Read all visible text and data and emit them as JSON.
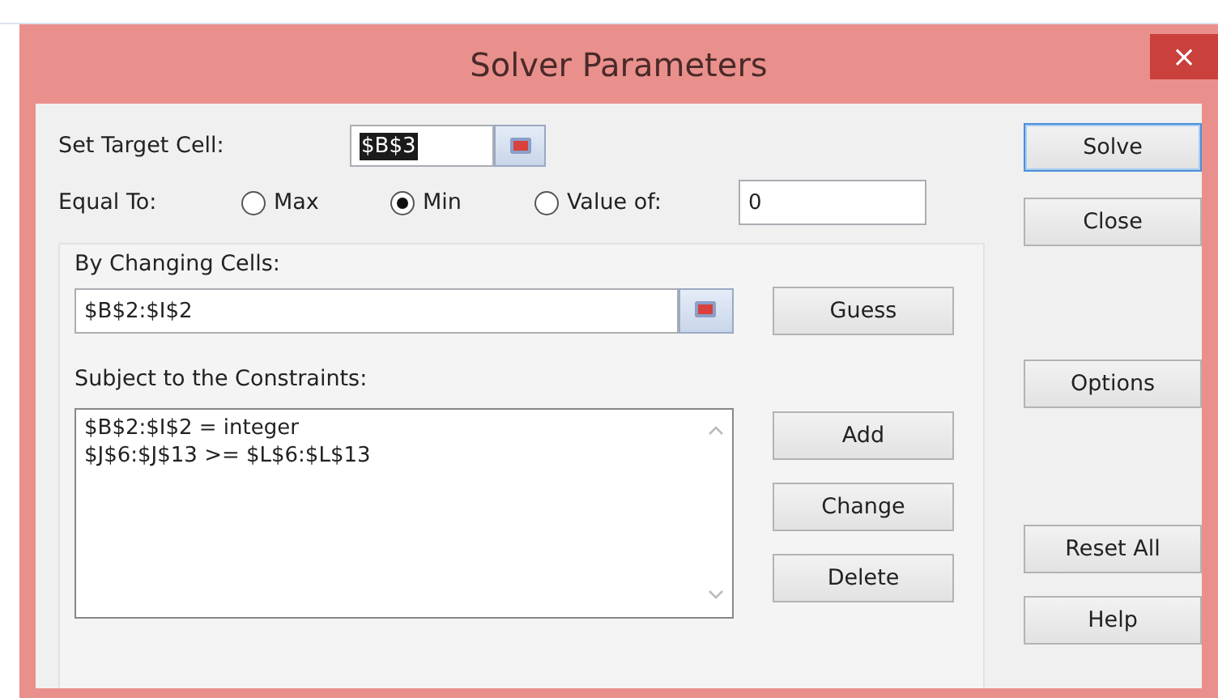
{
  "window": {
    "title": "Solver Parameters",
    "close": "×"
  },
  "target": {
    "label": "Set Target Cell:",
    "value": "$B$3",
    "value_selected": true
  },
  "equal_to": {
    "label": "Equal To:",
    "options": [
      {
        "label": "Max",
        "selected": false
      },
      {
        "label": "Min",
        "selected": true
      },
      {
        "label": "Value of:",
        "selected": false
      }
    ],
    "value": "0"
  },
  "changing": {
    "label": "By Changing Cells:",
    "value": "$B$2:$I$2",
    "button": "Guess"
  },
  "constraints": {
    "label": "Subject to the Constraints:",
    "items": [
      "$B$2:$I$2 = integer",
      "$J$6:$J$13 >= $L$6:$L$13"
    ],
    "buttons": [
      "Add",
      "Change",
      "Delete"
    ]
  },
  "side_buttons": [
    {
      "label": "Solve",
      "focused": true
    },
    {
      "label": "Close",
      "focused": false
    },
    {
      "label": "Options",
      "focused": false
    },
    {
      "label": "Reset All",
      "focused": false
    },
    {
      "label": "Help",
      "focused": false
    }
  ]
}
